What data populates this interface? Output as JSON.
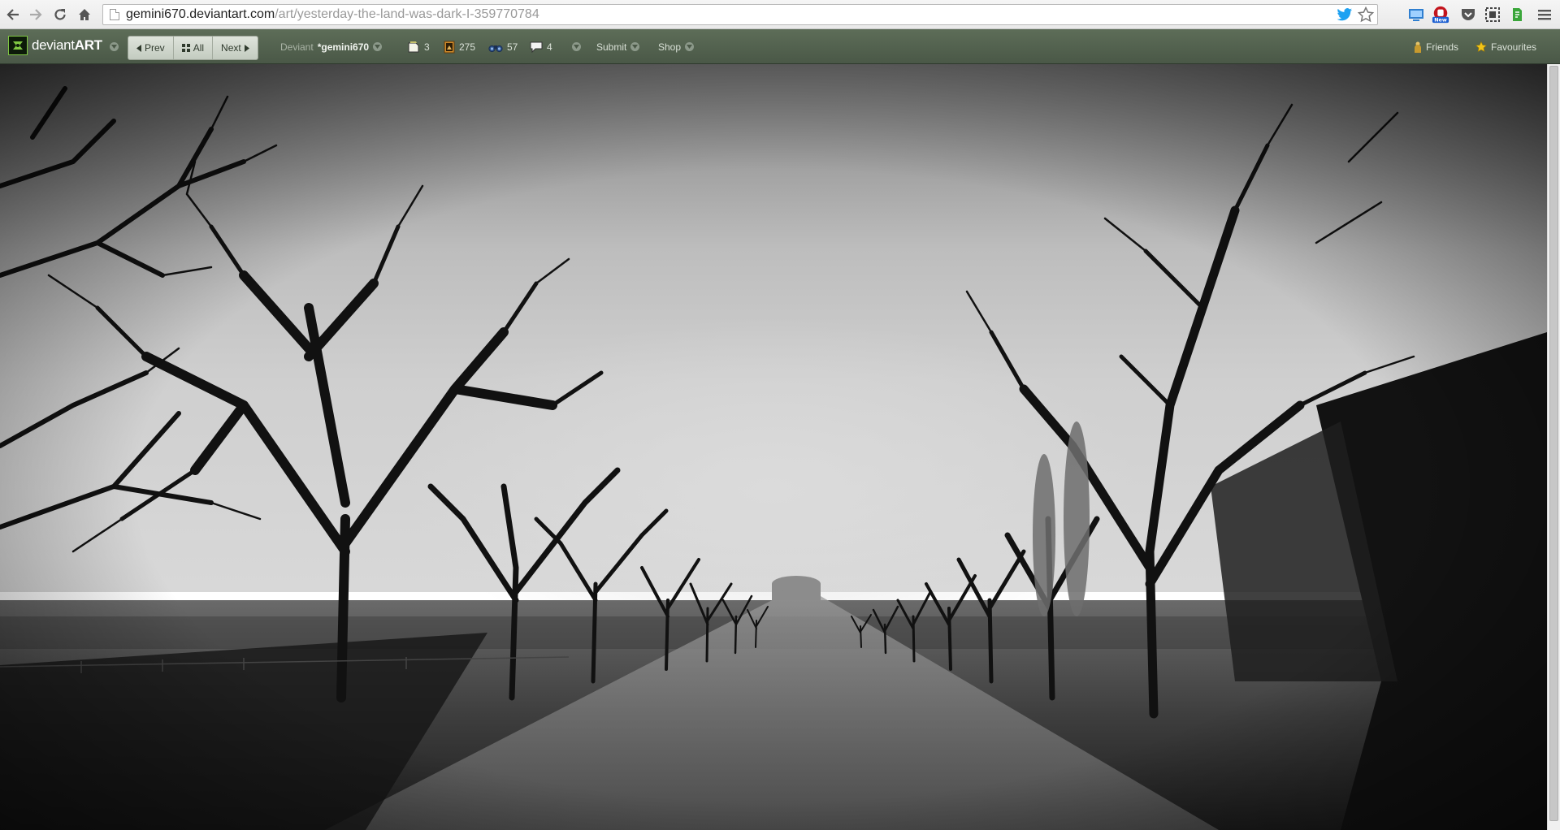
{
  "browser": {
    "url_host": "gemini670.deviantart.com",
    "url_path": "/art/yesterday-the-land-was-dark-I-359770784",
    "icons": [
      "back-icon",
      "forward-icon",
      "reload-icon",
      "home-icon",
      "page-icon",
      "twitter-icon",
      "star-icon",
      "menu-icon"
    ],
    "extensions": [
      {
        "name": "screen-capture-icon",
        "color": "#2f7fd0"
      },
      {
        "name": "adblock-icon",
        "color": "#c3141c",
        "badge": "New"
      },
      {
        "name": "pocket-icon",
        "color": "#555555"
      },
      {
        "name": "screenshot-icon",
        "color": "#444444"
      },
      {
        "name": "evernote-icon",
        "color": "#3aa63a"
      }
    ]
  },
  "da_bar": {
    "logo_main": "deviant",
    "logo_bold": "ART",
    "prev_label": "Prev",
    "all_label": "All",
    "next_label": "Next",
    "deviant_label": "Deviant",
    "username": "*gemini670",
    "notes_count": "3",
    "deviations_count": "275",
    "watch_count": "57",
    "comments_count": "4",
    "submit_label": "Submit",
    "shop_label": "Shop",
    "friends_label": "Friends",
    "favourites_label": "Favourites",
    "colors": {
      "bar": "#55654f",
      "logo_green": "#7fc742"
    }
  },
  "artwork": {
    "description_icon": "orchard-photo"
  }
}
